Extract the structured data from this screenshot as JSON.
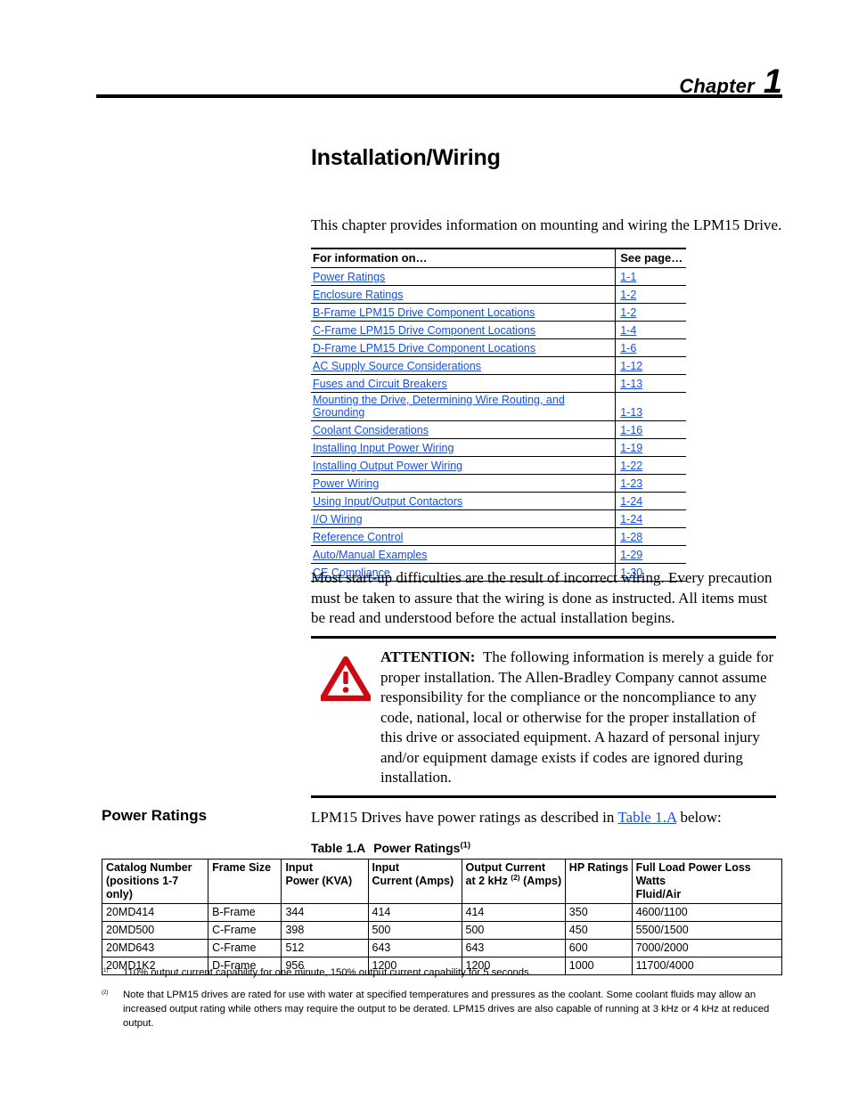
{
  "header": {
    "chapter_word": "Chapter",
    "chapter_number": "1"
  },
  "page_title": "Installation/Wiring",
  "intro_paragraph": "This chapter provides information on mounting and wiring the LPM15 Drive.",
  "toc": {
    "col_topic_header": "For information on…",
    "col_page_header": "See page…",
    "rows": [
      {
        "topic": "Power Ratings",
        "page": "1-1"
      },
      {
        "topic": "Enclosure Ratings",
        "page": "1-2"
      },
      {
        "topic": "B-Frame LPM15 Drive Component Locations",
        "page": "1-2"
      },
      {
        "topic": "C-Frame LPM15 Drive Component Locations",
        "page": "1-4"
      },
      {
        "topic": "D-Frame LPM15 Drive Component Locations",
        "page": "1-6"
      },
      {
        "topic": "AC Supply Source Considerations",
        "page": "1-12"
      },
      {
        "topic": "Fuses and Circuit Breakers",
        "page": "1-13"
      },
      {
        "topic": "Mounting the Drive, Determining Wire Routing, and Grounding",
        "page": "1-13"
      },
      {
        "topic": "Coolant Considerations",
        "page": "1-16"
      },
      {
        "topic": "Installing Input Power Wiring",
        "page": "1-19"
      },
      {
        "topic": "Installing Output Power Wiring",
        "page": "1-22"
      },
      {
        "topic": "Power Wiring",
        "page": "1-23"
      },
      {
        "topic": "Using Input/Output Contactors",
        "page": "1-24"
      },
      {
        "topic": "I/O Wiring",
        "page": "1-24"
      },
      {
        "topic": "Reference Control",
        "page": "1-28"
      },
      {
        "topic": "Auto/Manual Examples",
        "page": "1-29"
      },
      {
        "topic": "CE Compliance",
        "page": "1-30"
      }
    ]
  },
  "body_paragraph": "Most start-up difficulties are the result of incorrect wiring. Every precaution must be taken to assure that the wiring is done as instructed. All items must be read and understood before the actual installation begins.",
  "attention": {
    "icon": "warning-triangle-icon",
    "icon_color": "#CC0811",
    "label": "ATTENTION:",
    "text": "The following information is merely a guide for proper installation. The Allen-Bradley Company cannot assume responsibility for the compliance or the noncompliance to any code, national, local or otherwise for the proper installation of this drive or associated equipment. A hazard of personal injury and/or equipment damage exists if codes are ignored during installation."
  },
  "section": {
    "heading": "Power Ratings",
    "intro_before_link": "LPM15 Drives have power ratings as described in ",
    "intro_link": "Table 1.A",
    "intro_after_link": " below:",
    "link_color": "#1a4fd6"
  },
  "table_caption": {
    "number": "Table 1.A",
    "title": "Power Ratings",
    "footnote_marker": "(1)"
  },
  "power_table": {
    "headers": [
      {
        "line1": "Catalog Number",
        "line2": "(positions 1-7 only)"
      },
      {
        "line1": "Frame Size",
        "line2": ""
      },
      {
        "line1": "Input",
        "line2": "Power (KVA)"
      },
      {
        "line1": "Input",
        "line2": "Current (Amps)"
      },
      {
        "line1": "Output Current",
        "line2": "at 2 kHz ",
        "line2_sup": "(2)",
        "line2_tail": " (Amps)"
      },
      {
        "line1": "HP Ratings",
        "line2": ""
      },
      {
        "line1": "Full Load Power Loss Watts",
        "line2": "Fluid/Air"
      }
    ],
    "rows": [
      [
        "20MD414",
        "B-Frame",
        "344",
        "414",
        "414",
        "350",
        "4600/1100"
      ],
      [
        "20MD500",
        "C-Frame",
        "398",
        "500",
        "500",
        "450",
        "5500/1500"
      ],
      [
        "20MD643",
        "C-Frame",
        "512",
        "643",
        "643",
        "600",
        "7000/2000"
      ],
      [
        "20MD1K2",
        "D-Frame",
        "956",
        "1200",
        "1200",
        "1000",
        "11700/4000"
      ]
    ]
  },
  "footnotes": [
    {
      "marker": "(1)",
      "text": "110% output current capability for one minute, 150% output current capability for 5 seconds."
    },
    {
      "marker": "(2)",
      "text": "Note that LPM15 drives are rated for use with water at specified temperatures and pressures as the coolant. Some coolant fluids may allow an increased output rating while others may require the output to be derated. LPM15 drives are also capable of running at 3 kHz or 4 kHz at reduced output."
    }
  ]
}
